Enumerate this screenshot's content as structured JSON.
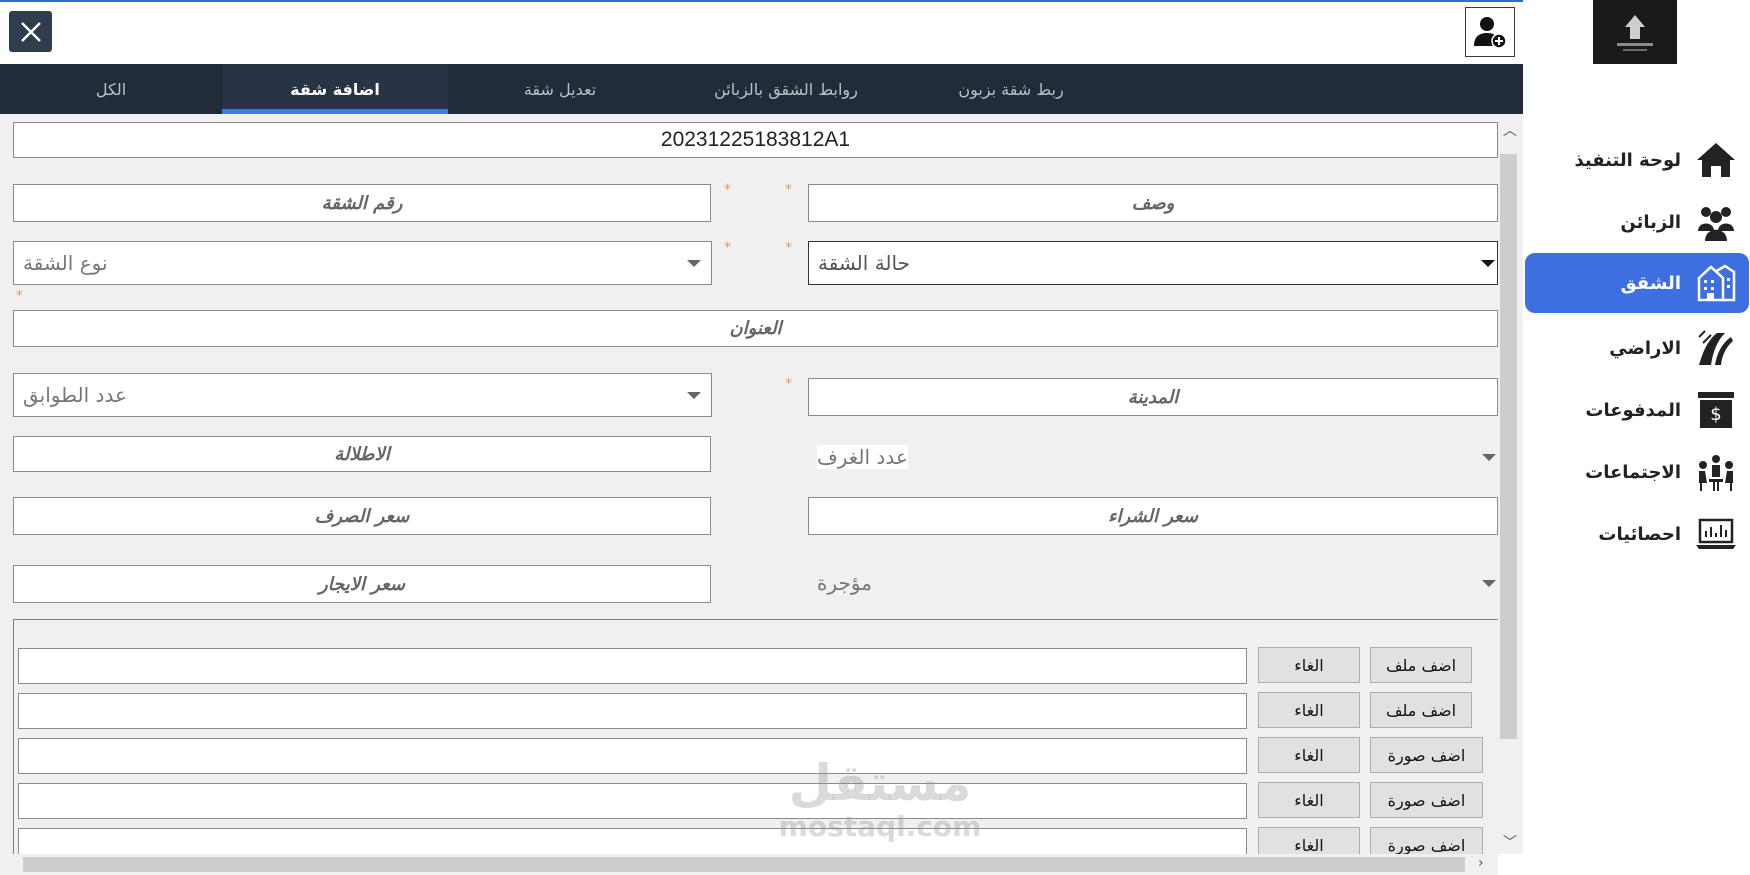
{
  "tabs": [
    {
      "label": "الكل"
    },
    {
      "label": "اضافة شقة"
    },
    {
      "label": "تعديل شقة"
    },
    {
      "label": "روابط الشقق بالزبائن"
    },
    {
      "label": "ربط شقة بزبون"
    }
  ],
  "form": {
    "id_value": "20231225183812A1",
    "description": "وصف",
    "apartment_number": "رقم الشقة",
    "apartment_status": "حالة الشقة",
    "apartment_type": "نوع الشقة",
    "address": "العنوان",
    "city": "المدينة",
    "floors_count": "عدد الطوابق",
    "rooms_count": "عدد الغرف",
    "view": "الاطلالة",
    "purchase_price": "سعر الشراء",
    "sale_price": "سعر الصرف",
    "rent_status": "مؤجرة",
    "rent_price": "سعر الايجار",
    "required_mark": "*"
  },
  "files": {
    "rows": [
      {
        "add_label": "اضف ملف",
        "cancel_label": "الغاء"
      },
      {
        "add_label": "اضف ملف",
        "cancel_label": "الغاء"
      },
      {
        "add_label": "اضف صورة",
        "cancel_label": "الغاء"
      },
      {
        "add_label": "اضف صورة",
        "cancel_label": "الغاء"
      },
      {
        "add_label": "اضف صورة",
        "cancel_label": "الغاء"
      }
    ]
  },
  "watermark": {
    "line1": "مستقل",
    "line2": "mostaql.com"
  },
  "sidebar": {
    "items": [
      {
        "label": "لوحة التنفيذ",
        "icon": "home-icon"
      },
      {
        "label": "الزبائن",
        "icon": "customers-icon"
      },
      {
        "label": "الشقق",
        "icon": "apartments-icon",
        "active": true
      },
      {
        "label": "الاراضي",
        "icon": "lands-icon"
      },
      {
        "label": "المدفوعات",
        "icon": "payments-icon"
      },
      {
        "label": "الاجتماعات",
        "icon": "meetings-icon"
      },
      {
        "label": "احصائيات",
        "icon": "statistics-icon"
      }
    ]
  },
  "colors": {
    "accent": "#3d6fe0",
    "tabbar": "#222b38",
    "close": "#2f3e4e"
  }
}
